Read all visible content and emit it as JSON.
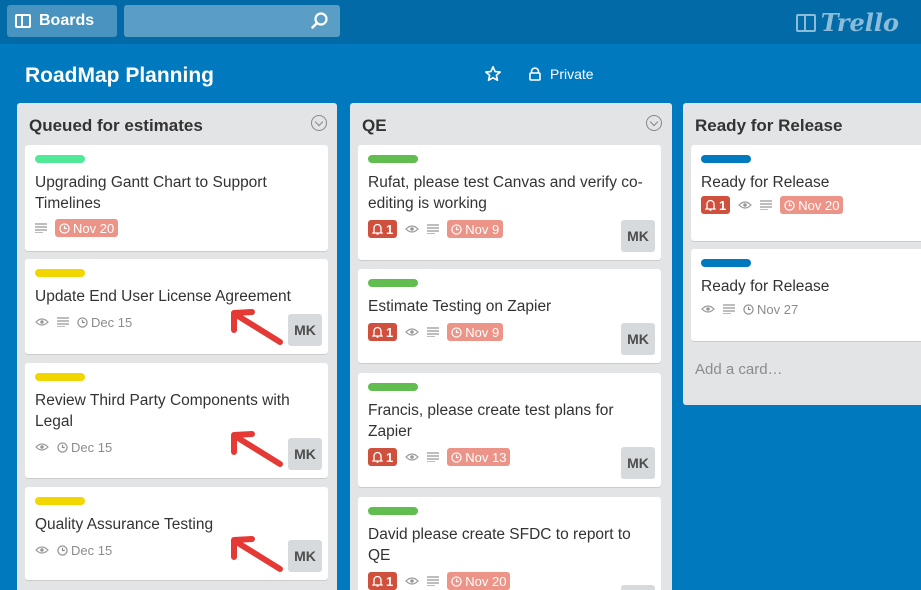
{
  "topbar": {
    "boards_label": "Boards",
    "search_placeholder": "",
    "logo_text": "Trello"
  },
  "board": {
    "title": "RoadMap Planning",
    "visibility": "Private"
  },
  "colors": {
    "background": "#0079bf",
    "label_green": "#61bd4f",
    "label_mint": "#51e898",
    "label_yellow": "#f2d600",
    "label_blue": "#0079bf",
    "overdue": "#ec9488",
    "notification": "#cf513d",
    "arrow": "#e53935"
  },
  "lists": [
    {
      "title": "Queued for estimates",
      "cards": [
        {
          "title": "Upgrading Gantt Chart to Support Timelines",
          "label_color": "#51e898",
          "due": "Nov 20",
          "due_overdue": true,
          "has_description": true
        },
        {
          "title": "Update End User License Agreement",
          "label_color": "#f2d600",
          "due": "Dec 15",
          "watching": true,
          "has_description": true,
          "member": "MK"
        },
        {
          "title": "Review Third Party Components with Legal",
          "label_color": "#f2d600",
          "due": "Dec 15",
          "watching": true,
          "member": "MK"
        },
        {
          "title": "Quality Assurance Testing",
          "label_color": "#f2d600",
          "due": "Dec 15",
          "watching": true,
          "member": "MK"
        }
      ]
    },
    {
      "title": "QE",
      "cards": [
        {
          "title": "Rufat, please test Canvas and verify co-editing is working",
          "label_color": "#61bd4f",
          "notifications": "1",
          "due": "Nov 9",
          "member": "MK"
        },
        {
          "title": "Estimate Testing on Zapier",
          "label_color": "#61bd4f",
          "notifications": "1",
          "due": "Nov 9",
          "member": "MK"
        },
        {
          "title": "Francis, please create test plans for Zapier",
          "label_color": "#61bd4f",
          "notifications": "1",
          "due": "Nov 13",
          "member": "MK"
        },
        {
          "title": "David please create SFDC to report to QE",
          "label_color": "#61bd4f",
          "notifications": "1",
          "due": "Nov 20",
          "member": "MK"
        }
      ]
    },
    {
      "title": "Ready for Release",
      "cards": [
        {
          "title": "Ready for Release",
          "label_color": "#0079bf",
          "notifications": "1",
          "due": "Nov 20"
        },
        {
          "title": "Ready for Release",
          "label_color": "#0079bf",
          "due": "Nov 27"
        }
      ],
      "add_card": "Add a card…"
    }
  ]
}
